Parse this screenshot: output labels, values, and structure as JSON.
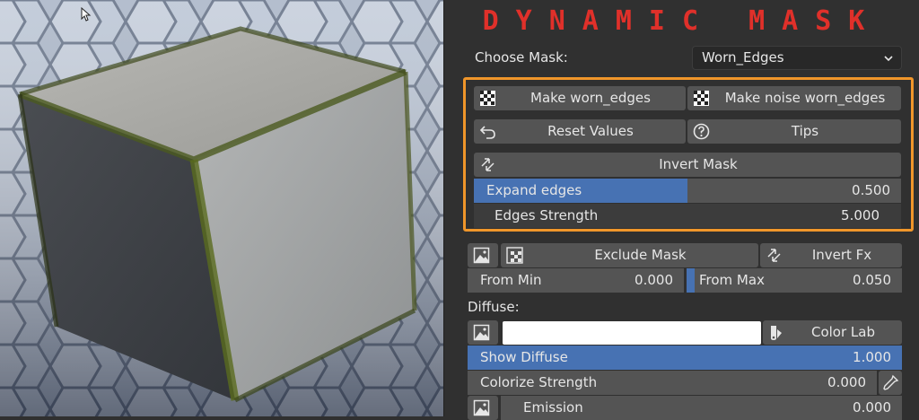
{
  "title": "DYNAMIC MASK",
  "choose_mask": {
    "label": "Choose Mask:",
    "value": "Worn_Edges"
  },
  "buttons": {
    "make_worn_edges": "Make worn_edges",
    "make_noise_worn_edges": "Make noise worn_edges",
    "reset_values": "Reset Values",
    "tips": "Tips",
    "invert_mask": "Invert Mask",
    "exclude_mask": "Exclude Mask",
    "invert_fx": "Invert Fx",
    "color_lab": "Color Lab"
  },
  "sliders": {
    "expand_edges": {
      "label": "Expand edges",
      "value": "0.500",
      "fill": 0.5
    },
    "edges_strength": {
      "label": "Edges Strength",
      "value": "5.000",
      "fill": 0
    },
    "from_min": {
      "label": "From Min",
      "value": "0.000"
    },
    "from_max": {
      "label": "From Max",
      "value": "0.050"
    },
    "show_diffuse": {
      "label": "Show Diffuse",
      "value": "1.000",
      "fill": 1
    },
    "colorize_strength": {
      "label": "Colorize Strength",
      "value": "0.000"
    },
    "emission": {
      "label": "Emission",
      "value": "0.000"
    }
  },
  "diffuse_label": "Diffuse:",
  "colors": {
    "title": "#e0302a",
    "highlight": "#f0962a",
    "slider_fill": "#4772b3"
  },
  "icons": [
    "cursor-icon",
    "chevron-down-icon",
    "checker-icon",
    "undo-icon",
    "help-icon",
    "invert-icon",
    "image-icon",
    "eyedropper-icon",
    "color-palette-icon"
  ]
}
